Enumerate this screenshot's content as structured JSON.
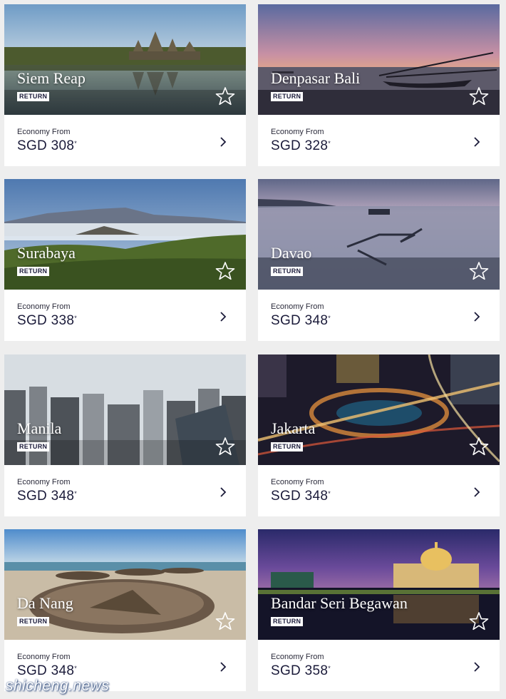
{
  "cards": [
    {
      "city": "Siem Reap",
      "badge": "RETURN",
      "fare_label": "Economy From",
      "price": "SGD 308",
      "asterisk": "*",
      "favorite_icon": "star-outline-icon",
      "open_icon": "chevron-right-icon"
    },
    {
      "city": "Denpasar Bali",
      "badge": "RETURN",
      "fare_label": "Economy From",
      "price": "SGD 328",
      "asterisk": "*",
      "favorite_icon": "star-outline-icon",
      "open_icon": "chevron-right-icon"
    },
    {
      "city": "Surabaya",
      "badge": "RETURN",
      "fare_label": "Economy From",
      "price": "SGD 338",
      "asterisk": "*",
      "favorite_icon": "star-outline-icon",
      "open_icon": "chevron-right-icon"
    },
    {
      "city": "Davao",
      "badge": "RETURN",
      "fare_label": "Economy From",
      "price": "SGD 348",
      "asterisk": "*",
      "favorite_icon": "star-outline-icon",
      "open_icon": "chevron-right-icon"
    },
    {
      "city": "Manila",
      "badge": "RETURN",
      "fare_label": "Economy From",
      "price": "SGD 348",
      "asterisk": "*",
      "favorite_icon": "star-outline-icon",
      "open_icon": "chevron-right-icon"
    },
    {
      "city": "Jakarta",
      "badge": "RETURN",
      "fare_label": "Economy From",
      "price": "SGD 348",
      "asterisk": "*",
      "favorite_icon": "star-outline-icon",
      "open_icon": "chevron-right-icon"
    },
    {
      "city": "Da Nang",
      "badge": "RETURN",
      "fare_label": "Economy From",
      "price": "SGD 348",
      "asterisk": "*",
      "favorite_icon": "star-outline-icon",
      "open_icon": "chevron-right-icon"
    },
    {
      "city": "Bandar Seri Begawan",
      "badge": "RETURN",
      "fare_label": "Economy From",
      "price": "SGD 358",
      "asterisk": "*",
      "favorite_icon": "star-outline-icon",
      "open_icon": "chevron-right-icon"
    }
  ],
  "watermark": "shicheng.news",
  "colors": {
    "page_bg": "#eeeeee",
    "card_bg": "#ffffff",
    "text_dark": "#1b1b3a",
    "badge_bg": "#ffffff"
  }
}
